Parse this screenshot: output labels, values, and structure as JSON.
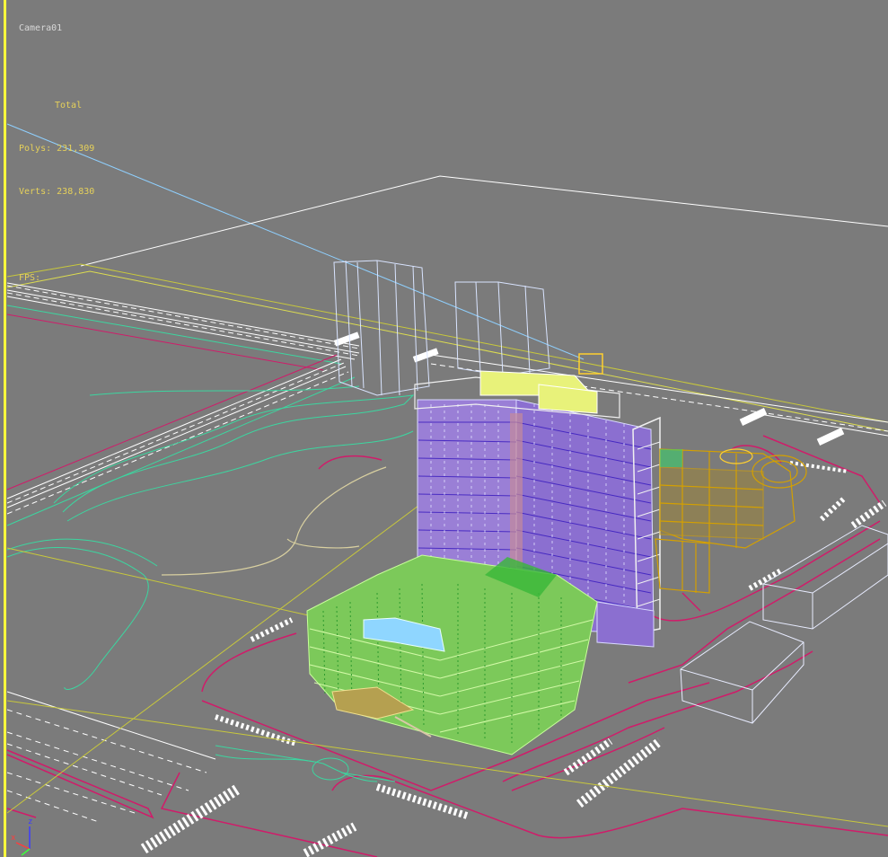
{
  "viewport": {
    "label": "Camera01",
    "stats": {
      "header": "Total",
      "polys_label": "Polys:",
      "polys_value": "231,309",
      "verts_label": "Verts:",
      "verts_value": "238,830",
      "fps_label": "FPS:"
    },
    "gizmo": {
      "axis_z": "z",
      "axis_x": "x"
    }
  },
  "colors": {
    "background": "#7b7b7b",
    "active_border": "#ffff3c",
    "stats_text": "#e6d15a",
    "tower": "#b8b8ff",
    "tower_fill": "#8a2be2",
    "podium": "#9cff70",
    "annex": "#d4a000",
    "roads": "#d01c6a",
    "paths": "#3cd6a0",
    "ghost_blocks": "#d9e4ff"
  }
}
